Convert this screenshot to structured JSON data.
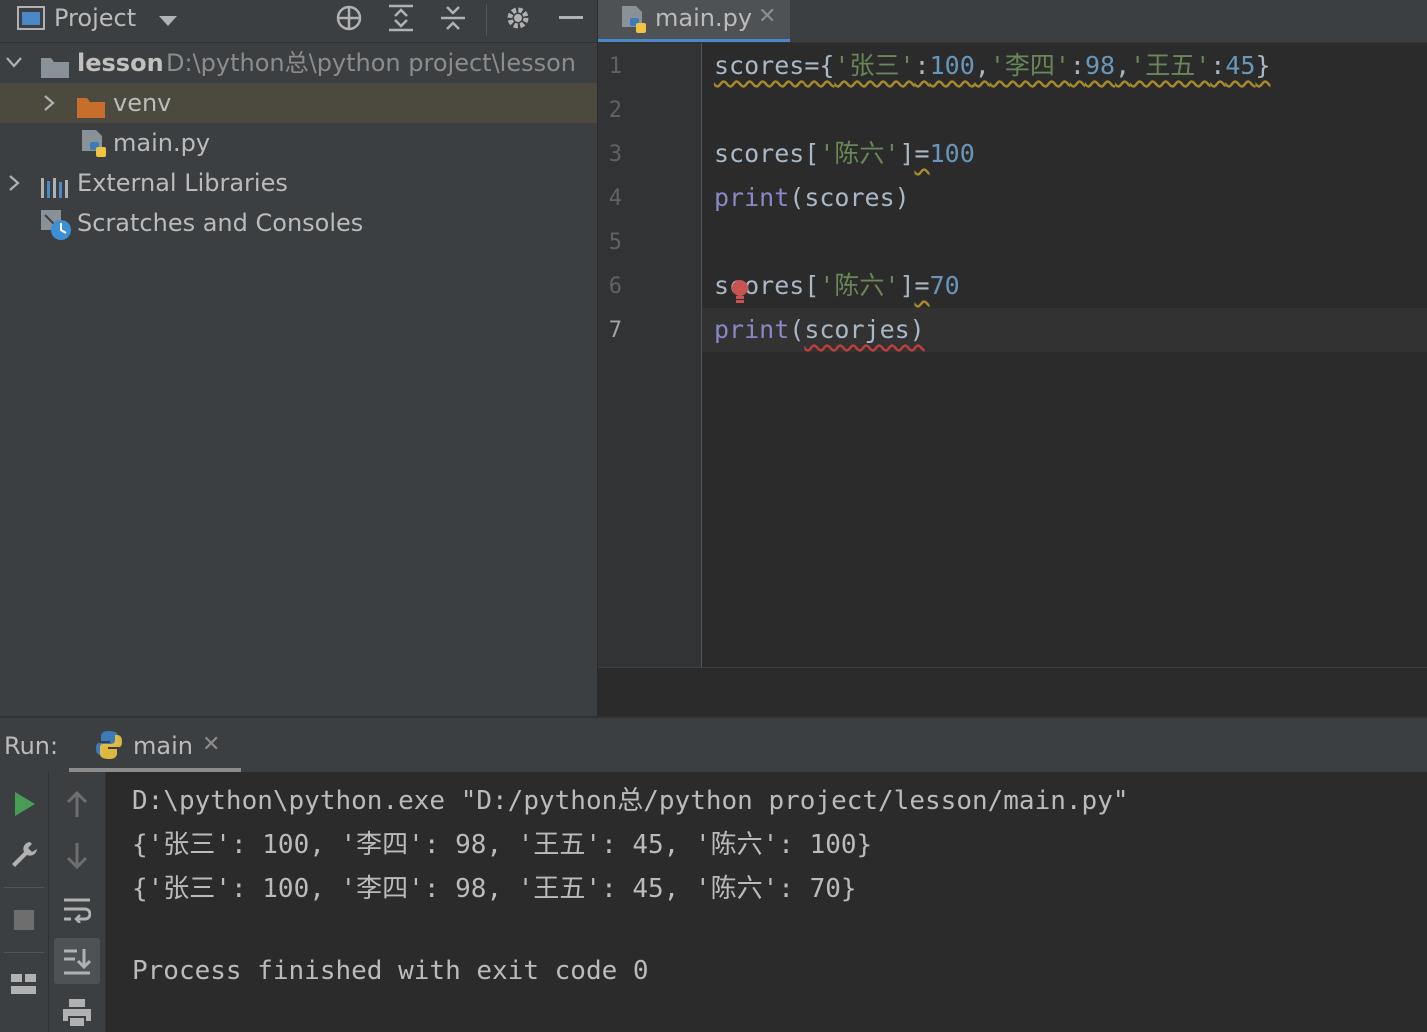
{
  "project_panel": {
    "title": "Project",
    "tree": [
      {
        "label": "lesson",
        "path": "D:\\python总\\python project\\lesson",
        "icon": "folder-icon"
      },
      {
        "label": "venv",
        "icon": "folder-excluded-icon"
      },
      {
        "label": "main.py",
        "icon": "python-file-icon"
      },
      {
        "label": "External Libraries",
        "icon": "libraries-icon"
      },
      {
        "label": "Scratches and Consoles",
        "icon": "scratches-icon"
      }
    ]
  },
  "editor": {
    "tab_label": "main.py",
    "line_numbers": [
      "1",
      "2",
      "3",
      "4",
      "5",
      "6",
      "7"
    ],
    "current_line": "7"
  },
  "run_panel": {
    "label": "Run:",
    "tab_label": "main",
    "output": [
      "D:\\python\\python.exe \"D:/python总/python project/lesson/main.py\"",
      "{'张三': 100, '李四': 98, '王五': 45, '陈六': 100}",
      "{'张三': 100, '李四': 98, '王五': 45, '陈六': 70}",
      "",
      "Process finished with exit code 0"
    ]
  },
  "colors": {
    "accent": "#4a88c7",
    "folder_orange": "#c86e2c",
    "run_green": "#499c54",
    "error_red": "#bc3f3c"
  }
}
